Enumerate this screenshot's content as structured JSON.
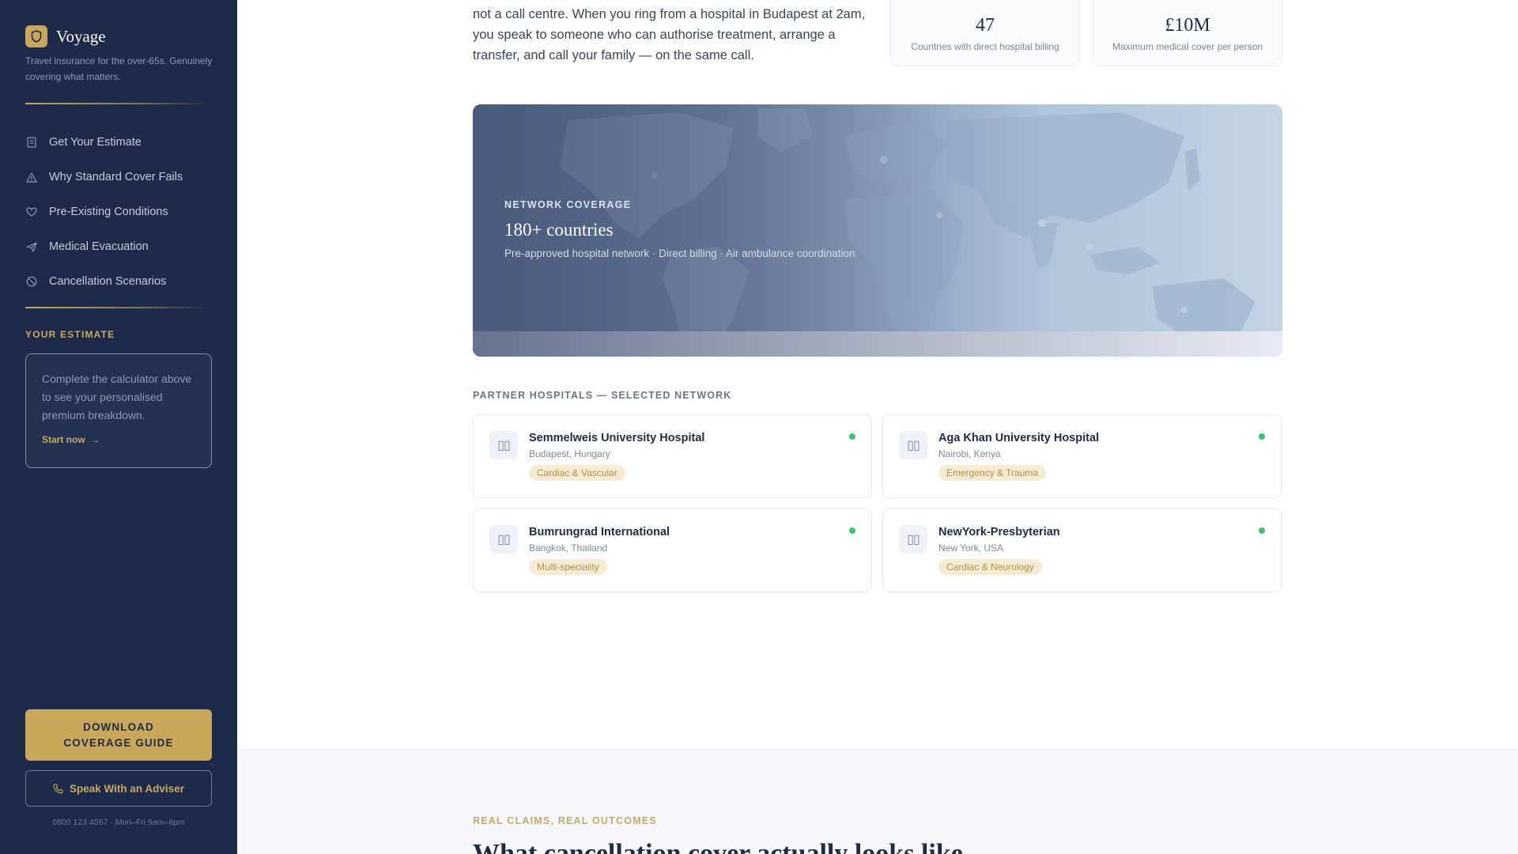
{
  "brand": {
    "name": "Voyage",
    "tagline": "Travel insurance for the over-65s. Genuinely covering what matters."
  },
  "nav": {
    "items": [
      {
        "label": "Get Your Estimate",
        "icon": "clipboard-icon"
      },
      {
        "label": "Why Standard Cover Fails",
        "icon": "warning-icon"
      },
      {
        "label": "Pre-Existing Conditions",
        "icon": "heart-icon"
      },
      {
        "label": "Medical Evacuation",
        "icon": "plane-icon"
      },
      {
        "label": "Cancellation Scenarios",
        "icon": "cancel-icon"
      }
    ]
  },
  "estimate": {
    "heading": "YOUR ESTIMATE",
    "text": "Complete the calculator above to see your personalised premium breakdown.",
    "link": "Start now"
  },
  "sidebar_actions": {
    "download_label": "DOWNLOAD COVERAGE GUIDE",
    "adviser_label": "Speak With an Adviser",
    "contact": "0800 123 4567 · Mon–Fri 9am–6pm"
  },
  "intro": {
    "text": "not a call centre. When you ring from a hospital in Budapest at 2am, you speak to someone who can authorise treatment, arrange a transfer, and call your family — on the same call."
  },
  "stats": [
    {
      "value": "47",
      "label": "Countries with direct hospital billing"
    },
    {
      "value": "£10M",
      "label": "Maximum medical cover per person"
    }
  ],
  "network": {
    "eyebrow": "NETWORK COVERAGE",
    "title": "180+ countries",
    "subtitle": "Pre-approved hospital network · Direct billing · Air ambulance coordination"
  },
  "partners": {
    "label": "PARTNER HOSPITALS — SELECTED NETWORK",
    "hospitals": [
      {
        "name": "Semmelweis University Hospital",
        "location": "Budapest, Hungary",
        "tag": "Cardiac & Vascular",
        "icon": "▯▯"
      },
      {
        "name": "Aga Khan University Hospital",
        "location": "Nairobi, Kenya",
        "tag": "Emergency & Trauma",
        "icon": "▯▯"
      },
      {
        "name": "Bumrungrad International",
        "location": "Bangkok, Thailand",
        "tag": "Multi-speciality",
        "icon": "▯▯"
      },
      {
        "name": "NewYork-Presbyterian",
        "location": "New York, USA",
        "tag": "Cardiac & Neurology",
        "icon": "▯▯"
      }
    ]
  },
  "claims": {
    "eyebrow": "REAL CLAIMS, REAL OUTCOMES",
    "title": "What cancellation cover actually looks like"
  },
  "colors": {
    "sidebar": "#1d2a49",
    "accent_gold": "#c9a85c",
    "status_green": "#3cc476"
  }
}
